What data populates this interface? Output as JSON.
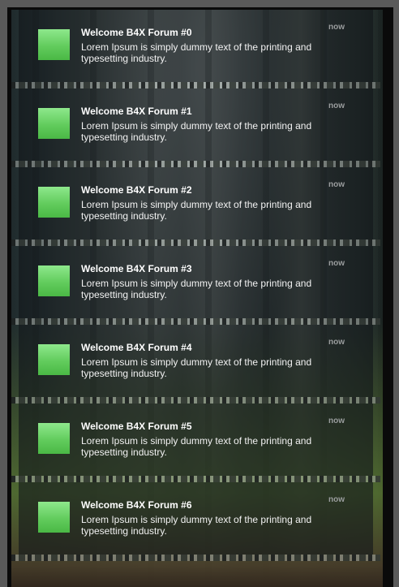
{
  "notifications": [
    {
      "title": "Welcome B4X Forum #0",
      "body": "Lorem Ipsum is simply dummy text of the printing and typesetting industry.",
      "time": "now"
    },
    {
      "title": "Welcome B4X Forum #1",
      "body": "Lorem Ipsum is simply dummy text of the printing and typesetting industry.",
      "time": "now"
    },
    {
      "title": "Welcome B4X Forum #2",
      "body": "Lorem Ipsum is simply dummy text of the printing and typesetting industry.",
      "time": "now"
    },
    {
      "title": "Welcome B4X Forum #3",
      "body": "Lorem Ipsum is simply dummy text of the printing and typesetting industry.",
      "time": "now"
    },
    {
      "title": "Welcome B4X Forum #4",
      "body": "Lorem Ipsum is simply dummy text of the printing and typesetting industry.",
      "time": "now"
    },
    {
      "title": "Welcome B4X Forum #5",
      "body": "Lorem Ipsum is simply dummy text of the printing and typesetting industry.",
      "time": "now"
    },
    {
      "title": "Welcome B4X Forum #6",
      "body": "Lorem Ipsum is simply dummy text of the printing and typesetting industry.",
      "time": "now"
    }
  ],
  "colors": {
    "thumb_accent": "#62cc5d",
    "card_background": "#12161a",
    "time_text": "#9a9d9e"
  }
}
